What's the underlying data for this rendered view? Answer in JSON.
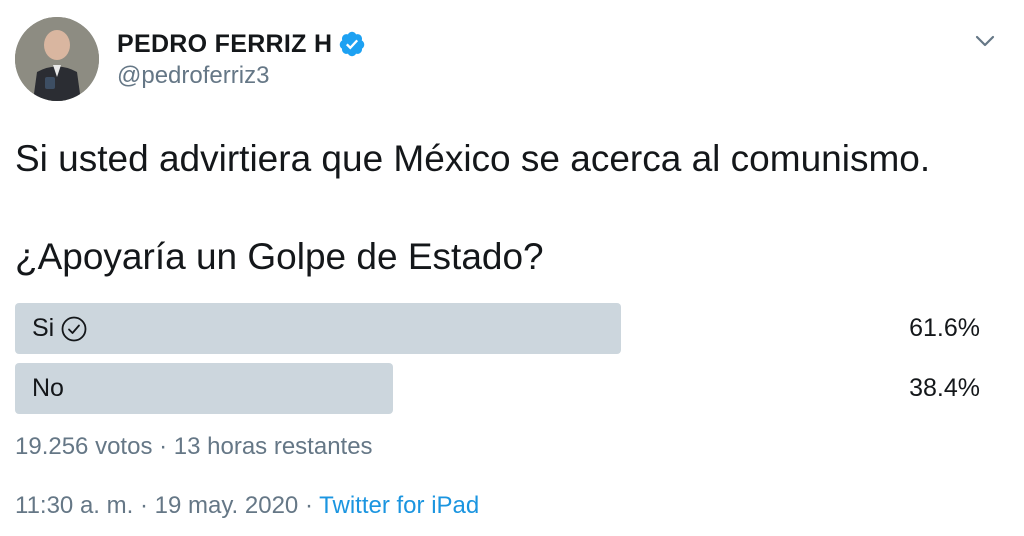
{
  "author": {
    "name": "PEDRO FERRIZ H",
    "handle": "@pedroferriz3",
    "verified": true,
    "avatar_icon": "profile-photo"
  },
  "tweet": {
    "text_line1": "Si usted advirtiera que México se acerca al comunismo.",
    "text_line2": "¿Apoyaría un Golpe de Estado?"
  },
  "poll": {
    "options": [
      {
        "label": "Si",
        "percent_text": "61.6%",
        "fraction": 0.616,
        "selected": true
      },
      {
        "label": "No",
        "percent_text": "38.4%",
        "fraction": 0.384,
        "selected": false
      }
    ],
    "meta": "19.256 votos · 13 horas restantes"
  },
  "footer": {
    "timestamp": "11:30 a. m. · 19 may. 2020",
    "separator": "·",
    "source": "Twitter for iPad"
  },
  "colors": {
    "text": "#14171a",
    "secondary": "#657786",
    "poll_bar": "#ccd6dd",
    "link": "#1b95e0",
    "verified_badge": "#1da1f2"
  },
  "icons": {
    "verified": "verified-badge-icon",
    "menu": "chevron-down-icon",
    "vote": "check-circle-icon"
  }
}
